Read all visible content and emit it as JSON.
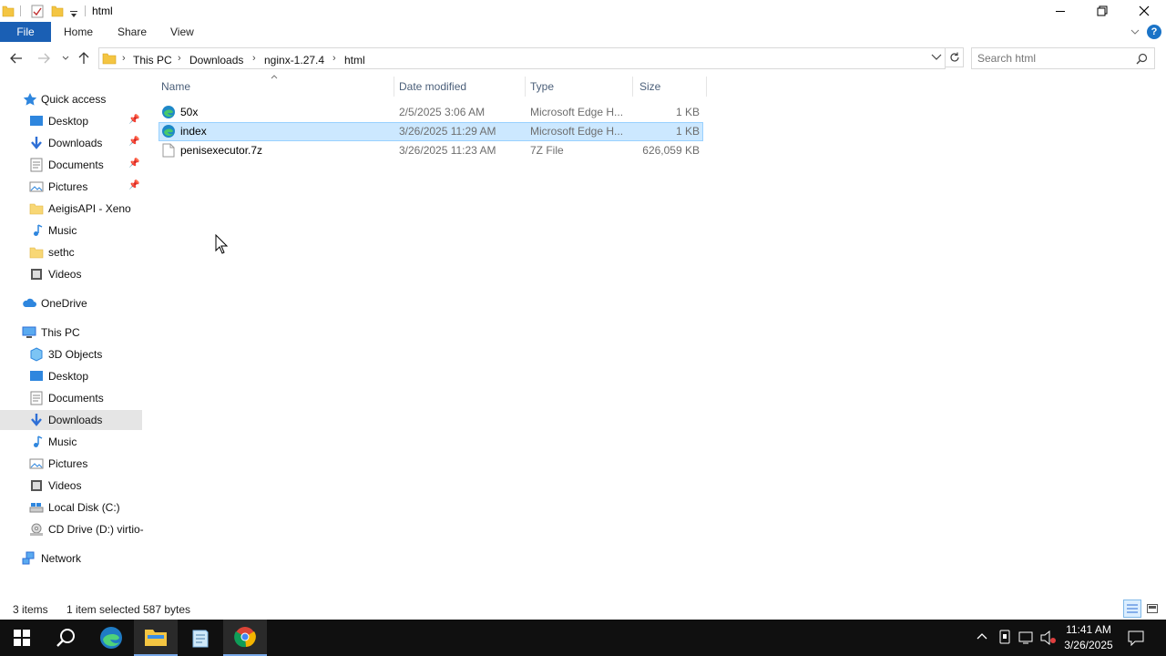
{
  "window": {
    "title": "html",
    "controls": [
      "minimize-icon",
      "restore-icon",
      "close-icon"
    ]
  },
  "ribbon": {
    "tabs": [
      {
        "label": "File"
      },
      {
        "label": "Home"
      },
      {
        "label": "Share"
      },
      {
        "label": "View"
      }
    ]
  },
  "address": {
    "crumbs": [
      "This PC",
      "Downloads",
      "nginx-1.27.4",
      "html"
    ]
  },
  "search": {
    "placeholder": "Search html"
  },
  "nav": {
    "quick_access": {
      "label": "Quick access",
      "items": [
        {
          "label": "Desktop",
          "icon": "desktop-icon",
          "pinned": true
        },
        {
          "label": "Downloads",
          "icon": "downloads-icon",
          "pinned": true
        },
        {
          "label": "Documents",
          "icon": "documents-icon",
          "pinned": true
        },
        {
          "label": "Pictures",
          "icon": "pictures-icon",
          "pinned": true
        },
        {
          "label": "AeigisAPI - Xeno",
          "icon": "folder-icon",
          "pinned": false
        },
        {
          "label": "Music",
          "icon": "music-icon",
          "pinned": false
        },
        {
          "label": "sethc",
          "icon": "folder-icon",
          "pinned": false
        },
        {
          "label": "Videos",
          "icon": "videos-icon",
          "pinned": false
        }
      ]
    },
    "onedrive": {
      "label": "OneDrive"
    },
    "this_pc": {
      "label": "This PC",
      "items": [
        {
          "label": "3D Objects",
          "icon": "3d-objects-icon"
        },
        {
          "label": "Desktop",
          "icon": "desktop-icon"
        },
        {
          "label": "Documents",
          "icon": "documents-icon"
        },
        {
          "label": "Downloads",
          "icon": "downloads-icon",
          "selected": true
        },
        {
          "label": "Music",
          "icon": "music-icon"
        },
        {
          "label": "Pictures",
          "icon": "pictures-icon"
        },
        {
          "label": "Videos",
          "icon": "videos-icon"
        },
        {
          "label": "Local Disk (C:)",
          "icon": "local-disk-icon"
        },
        {
          "label": "CD Drive (D:) virtio-",
          "icon": "cd-drive-icon"
        }
      ]
    },
    "network": {
      "label": "Network"
    }
  },
  "filelist": {
    "columns": [
      "Name",
      "Date modified",
      "Type",
      "Size"
    ],
    "rows": [
      {
        "name": "50x",
        "date": "2/5/2025 3:06 AM",
        "type": "Microsoft Edge H...",
        "size": "1 KB",
        "icon": "edge-html-icon",
        "selected": false
      },
      {
        "name": "index",
        "date": "3/26/2025 11:29 AM",
        "type": "Microsoft Edge H...",
        "size": "1 KB",
        "icon": "edge-html-icon",
        "selected": true
      },
      {
        "name": "penisexecutor.7z",
        "date": "3/26/2025 11:23 AM",
        "type": "7Z File",
        "size": "626,059 KB",
        "icon": "file-icon",
        "selected": false
      }
    ]
  },
  "status": {
    "item_count": "3 items",
    "selection": "1 item selected",
    "selection_size": "587 bytes"
  },
  "taskbar": {
    "time": "11:41 AM",
    "date": "3/26/2025"
  },
  "colors": {
    "accent": "#1a5fb4",
    "selection_bg": "#cce8ff",
    "taskbar_bg": "#101010"
  }
}
